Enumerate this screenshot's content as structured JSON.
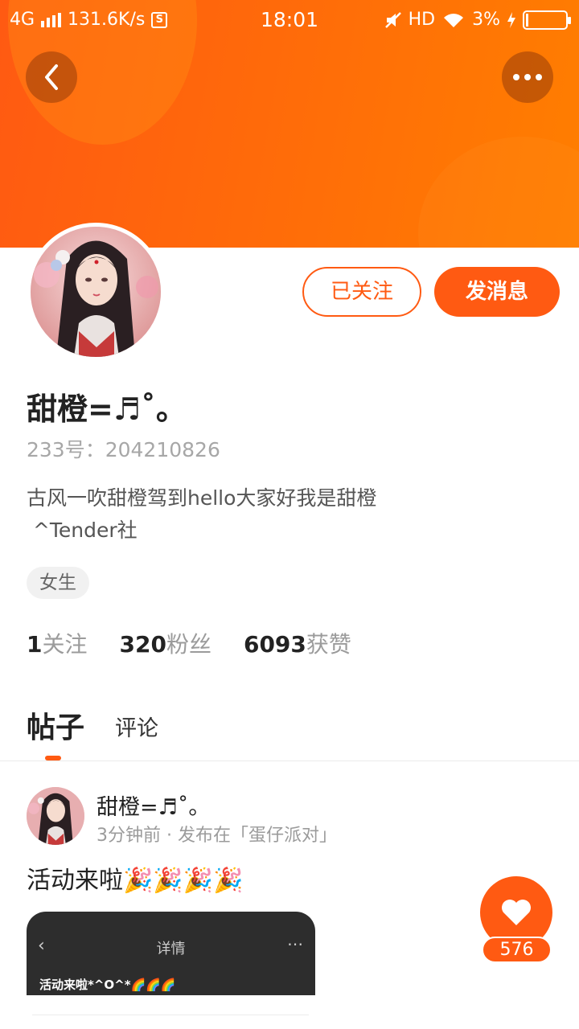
{
  "status_bar": {
    "network": "4G",
    "speed": "131.6K/s",
    "s_badge": "S",
    "time": "18:01",
    "hd": "HD",
    "battery": "3%"
  },
  "profile": {
    "nickname": "甜橙=♬˚。",
    "uid": "233号：204210826",
    "bio": "古风一吹甜橙驾到hello大家好我是甜橙\n ^Tender社",
    "gender_tag": "女生",
    "follow_button": "已关注",
    "message_button": "发消息",
    "stats": [
      {
        "num": "1",
        "label": "关注"
      },
      {
        "num": "320",
        "label": "粉丝"
      },
      {
        "num": "6093",
        "label": "获赞"
      }
    ]
  },
  "tabs": {
    "posts": "帖子",
    "comments": "评论"
  },
  "post": {
    "author": "甜橙=♬˚。",
    "meta": "3分钟前 · 发布在「蛋仔派对」",
    "text": "活动来啦🎉🎉🎉🎉",
    "image": {
      "title": "详情",
      "text": "活动来啦*^O^*🌈🌈🌈"
    }
  },
  "like": {
    "count": "576"
  },
  "colors": {
    "accent": "#ff5a12",
    "banner_end": "#ff7e00"
  }
}
